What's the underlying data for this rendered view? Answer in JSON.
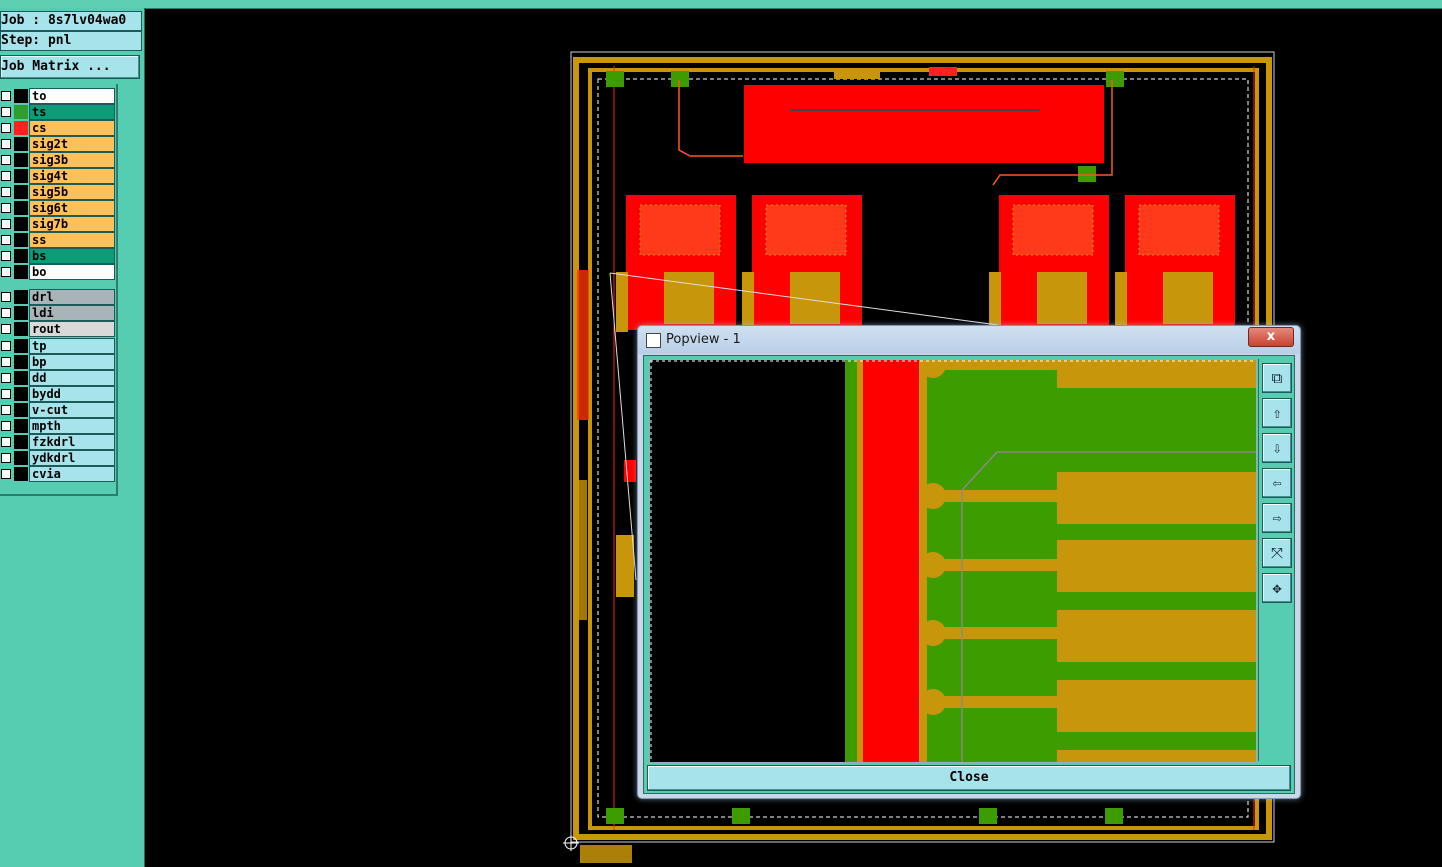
{
  "sidebar": {
    "job_line": "Job : 8s7lv04wa0",
    "step_line": "Step: pnl",
    "job_matrix_button": "Job Matrix ...",
    "layers_group1": [
      {
        "name": "to",
        "swatch": "#000000",
        "fill": "#ffffff"
      },
      {
        "name": "ts",
        "swatch": "#2e9e2e",
        "fill": "#0e9c78"
      },
      {
        "name": "cs",
        "swatch": "#ff2020",
        "fill": "#fcc15a"
      },
      {
        "name": "sig2t",
        "swatch": "#000000",
        "fill": "#fcc15a"
      },
      {
        "name": "sig3b",
        "swatch": "#000000",
        "fill": "#fcc15a"
      },
      {
        "name": "sig4t",
        "swatch": "#000000",
        "fill": "#fcc15a"
      },
      {
        "name": "sig5b",
        "swatch": "#000000",
        "fill": "#fcc15a"
      },
      {
        "name": "sig6t",
        "swatch": "#000000",
        "fill": "#fcc15a"
      },
      {
        "name": "sig7b",
        "swatch": "#000000",
        "fill": "#fcc15a"
      },
      {
        "name": "ss",
        "swatch": "#000000",
        "fill": "#fcc15a"
      },
      {
        "name": "bs",
        "swatch": "#000000",
        "fill": "#0e9c78"
      },
      {
        "name": "bo",
        "swatch": "#000000",
        "fill": "#ffffff"
      }
    ],
    "layers_group2": [
      {
        "name": "drl",
        "swatch": "#000000",
        "fill": "#a8b4b8"
      },
      {
        "name": "ldi",
        "swatch": "#000000",
        "fill": "#a8b4b8"
      },
      {
        "name": "rout",
        "swatch": "#000000",
        "fill": "#d9d9d9"
      }
    ],
    "layers_group3": [
      {
        "name": "tp",
        "swatch": "#000000",
        "fill": "#a7e3ea"
      },
      {
        "name": "bp",
        "swatch": "#000000",
        "fill": "#a7e3ea"
      },
      {
        "name": "dd",
        "swatch": "#000000",
        "fill": "#a7e3ea"
      },
      {
        "name": "bydd",
        "swatch": "#000000",
        "fill": "#a7e3ea"
      },
      {
        "name": "v-cut",
        "swatch": "#000000",
        "fill": "#a7e3ea"
      },
      {
        "name": "mpth",
        "swatch": "#000000",
        "fill": "#a7e3ea"
      },
      {
        "name": "fzkdrl",
        "swatch": "#000000",
        "fill": "#a7e3ea"
      },
      {
        "name": "ydkdrl",
        "swatch": "#000000",
        "fill": "#a7e3ea"
      },
      {
        "name": "cvia",
        "swatch": "#000000",
        "fill": "#a7e3ea"
      }
    ]
  },
  "popview": {
    "title": "Popview - 1",
    "close_x": "x",
    "close_button": "Close",
    "toolbar_icons": [
      "zoom-window-icon",
      "pan-up-icon",
      "pan-down-icon",
      "pan-left-icon",
      "pan-right-icon",
      "zoom-fit-icon",
      "zoom-out-icon"
    ]
  },
  "colors": {
    "copper_red": "#ff0000",
    "frame_gold": "#c8960a",
    "pad_green": "#3d9c00",
    "gui_teal": "#56cdb0"
  }
}
